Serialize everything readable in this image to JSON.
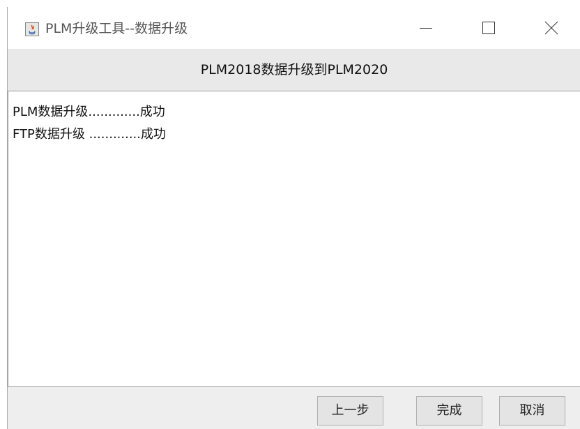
{
  "window": {
    "title": "PLM升级工具--数据升级",
    "icon": "java-app-icon",
    "controls": [
      "minimize-icon",
      "maximize-icon",
      "close-icon"
    ]
  },
  "header": {
    "title": "PLM2018数据升级到PLM2020"
  },
  "log": {
    "lines": [
      "PLM数据升级.............成功",
      "FTP数据升级 .............成功"
    ]
  },
  "buttons": {
    "prev_label": "上一步",
    "finish_label": "完成",
    "cancel_label": "取消"
  }
}
